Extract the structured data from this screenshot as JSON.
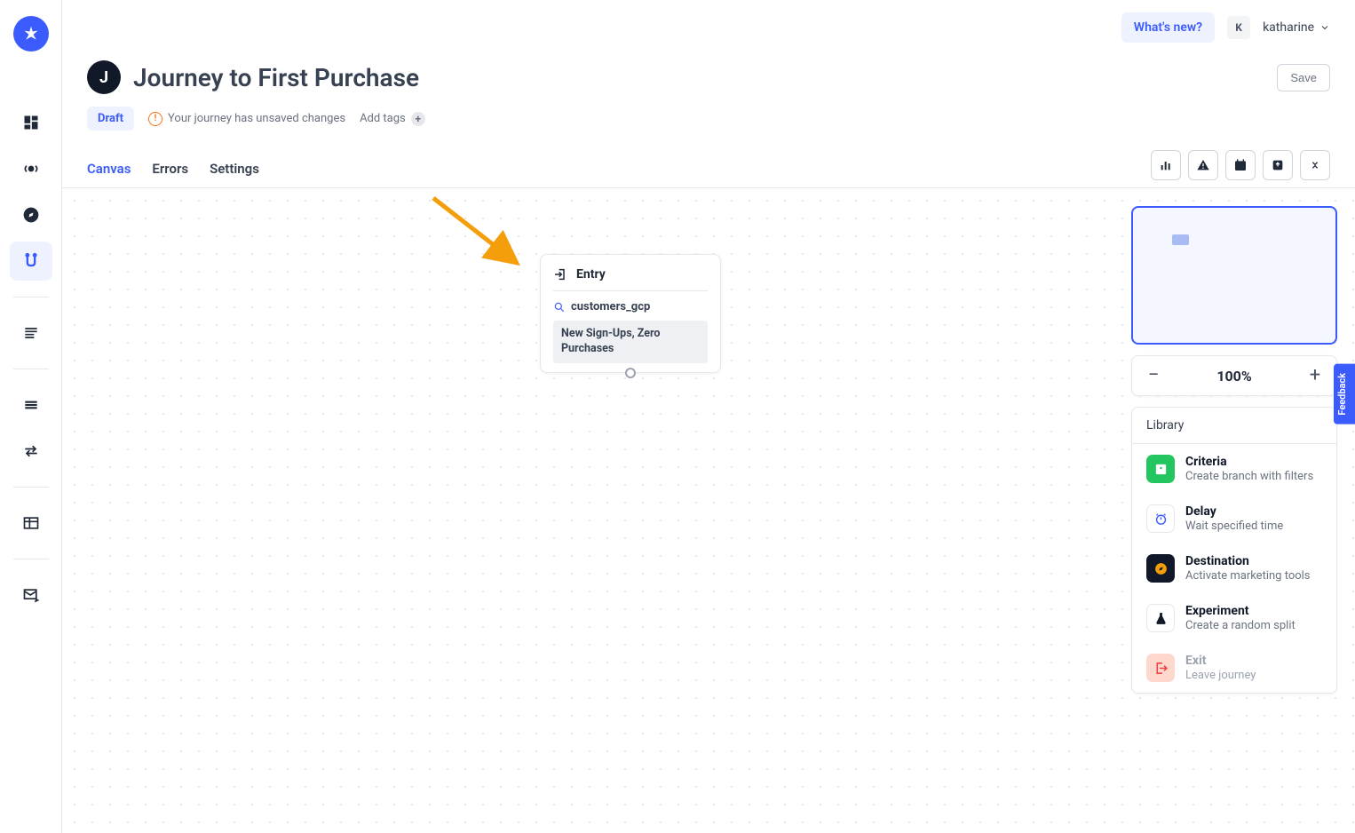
{
  "topbar": {
    "whats_new": "What's new?",
    "user_initial": "K",
    "user_name": "katharine"
  },
  "header": {
    "icon_letter": "J",
    "title": "Journey to First Purchase",
    "save_label": "Save",
    "draft_badge": "Draft",
    "unsaved_msg": "Your journey has unsaved changes",
    "add_tags": "Add tags"
  },
  "tabs": {
    "canvas": "Canvas",
    "errors": "Errors",
    "settings": "Settings"
  },
  "canvas": {
    "entry_label": "Entry",
    "entry_source": "customers_gcp",
    "entry_audience": "New Sign-Ups, Zero Purchases"
  },
  "zoom": {
    "value": "100%"
  },
  "library": {
    "heading": "Library",
    "items": [
      {
        "title": "Criteria",
        "desc": "Create branch with filters"
      },
      {
        "title": "Delay",
        "desc": "Wait specified time"
      },
      {
        "title": "Destination",
        "desc": "Activate marketing tools"
      },
      {
        "title": "Experiment",
        "desc": "Create a random split"
      },
      {
        "title": "Exit",
        "desc": "Leave journey"
      }
    ]
  },
  "feedback": "Feedback"
}
